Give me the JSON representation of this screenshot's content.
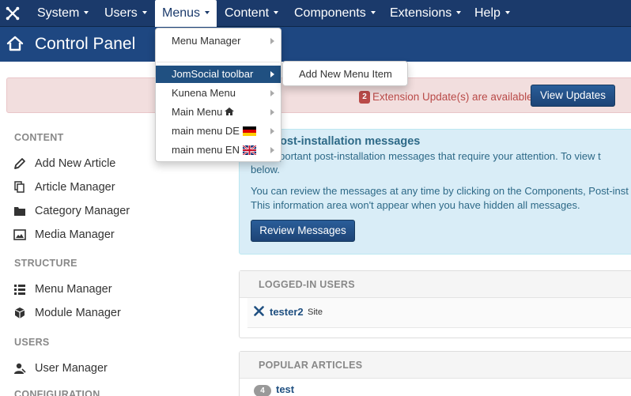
{
  "topnav": {
    "items": [
      {
        "label": "System"
      },
      {
        "label": "Users"
      },
      {
        "label": "Menus"
      },
      {
        "label": "Content"
      },
      {
        "label": "Components"
      },
      {
        "label": "Extensions"
      },
      {
        "label": "Help"
      }
    ]
  },
  "header": {
    "title": "Control Panel"
  },
  "alert": {
    "count": "2",
    "text": "Extension Update(s) are available:",
    "button": "View Updates"
  },
  "sidebar": {
    "sections": [
      {
        "heading": "CONTENT",
        "items": [
          {
            "label": "Add New Article",
            "icon": "pencil-icon"
          },
          {
            "label": "Article Manager",
            "icon": "copy-icon"
          },
          {
            "label": "Category Manager",
            "icon": "folder-icon"
          },
          {
            "label": "Media Manager",
            "icon": "image-icon"
          }
        ]
      },
      {
        "heading": "STRUCTURE",
        "items": [
          {
            "label": "Menu Manager",
            "icon": "list-icon"
          },
          {
            "label": "Module Manager",
            "icon": "cube-icon"
          }
        ]
      },
      {
        "heading": "USERS",
        "items": [
          {
            "label": "User Manager",
            "icon": "user-icon"
          }
        ]
      },
      {
        "heading": "CONFIGURATION",
        "items": []
      }
    ]
  },
  "postinstall": {
    "heading": "ave post-installation messages",
    "line1": "are important post-installation messages that require your attention. To view t",
    "line2": "below.",
    "line3": "You can review the messages at any time by clicking on the Components, Post-inst",
    "line4": "This information area won't appear when you have hidden all messages.",
    "button": "Review Messages"
  },
  "logged_in": {
    "heading": "LOGGED-IN USERS",
    "user": "tester2",
    "location": "Site"
  },
  "popular": {
    "heading": "POPULAR ARTICLES",
    "hits": "4",
    "article": "test"
  },
  "menus_dropdown": {
    "items": [
      {
        "label": "Menu Manager"
      },
      {
        "label": "JomSocial toolbar"
      },
      {
        "label": "Kunena Menu"
      },
      {
        "label": "Main Menu"
      },
      {
        "label": "main menu DE"
      },
      {
        "label": "main menu EN"
      }
    ],
    "submenu": {
      "label": "Add New Menu Item"
    }
  },
  "colors": {
    "nav_bg": "#1b3a6b",
    "header_bg": "#1e4781",
    "primary": "#205081",
    "alert_bg": "#f2dede",
    "info_bg": "#d9edf7"
  }
}
